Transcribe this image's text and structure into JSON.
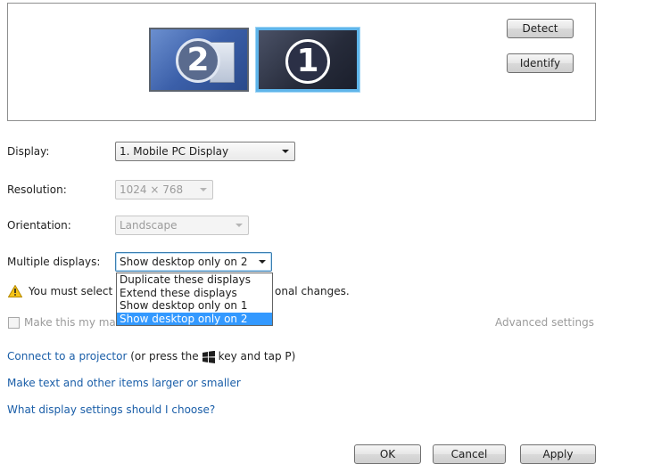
{
  "preview": {
    "monitor_2_number": "2",
    "monitor_1_number": "1",
    "detect_label": "Detect",
    "identify_label": "Identify"
  },
  "settings": {
    "display_label": "Display:",
    "display_value": "1. Mobile PC Display",
    "resolution_label": "Resolution:",
    "resolution_value": "1024 × 768",
    "orientation_label": "Orientation:",
    "orientation_value": "Landscape",
    "multiple_label": "Multiple displays:",
    "multiple_value": "Show desktop only on 2"
  },
  "dropdown": {
    "options": [
      "Duplicate these displays",
      "Extend these displays",
      "Show desktop only on 1",
      "Show desktop only on 2"
    ],
    "selected_index": 3
  },
  "warning": {
    "text_left": "You must select",
    "text_right": "onal changes."
  },
  "checkbox": {
    "label": "Make this my ma",
    "checked": false
  },
  "advanced_settings": "Advanced settings",
  "links": {
    "projector": "Connect to a projector",
    "projector_suffix_a": "(or press the",
    "projector_suffix_b": "key and tap P)",
    "text_size": "Make text and other items larger or smaller",
    "help": "What display settings should I choose?"
  },
  "buttons": {
    "ok": "OK",
    "cancel": "Cancel",
    "apply": "Apply"
  },
  "colors": {
    "link": "#1a5ea8",
    "selection": "#3399ff",
    "monitor_1_border": "#5fb5ea"
  },
  "icons": [
    "warning-icon",
    "windows-logo-icon",
    "dropdown-arrow-icon"
  ]
}
